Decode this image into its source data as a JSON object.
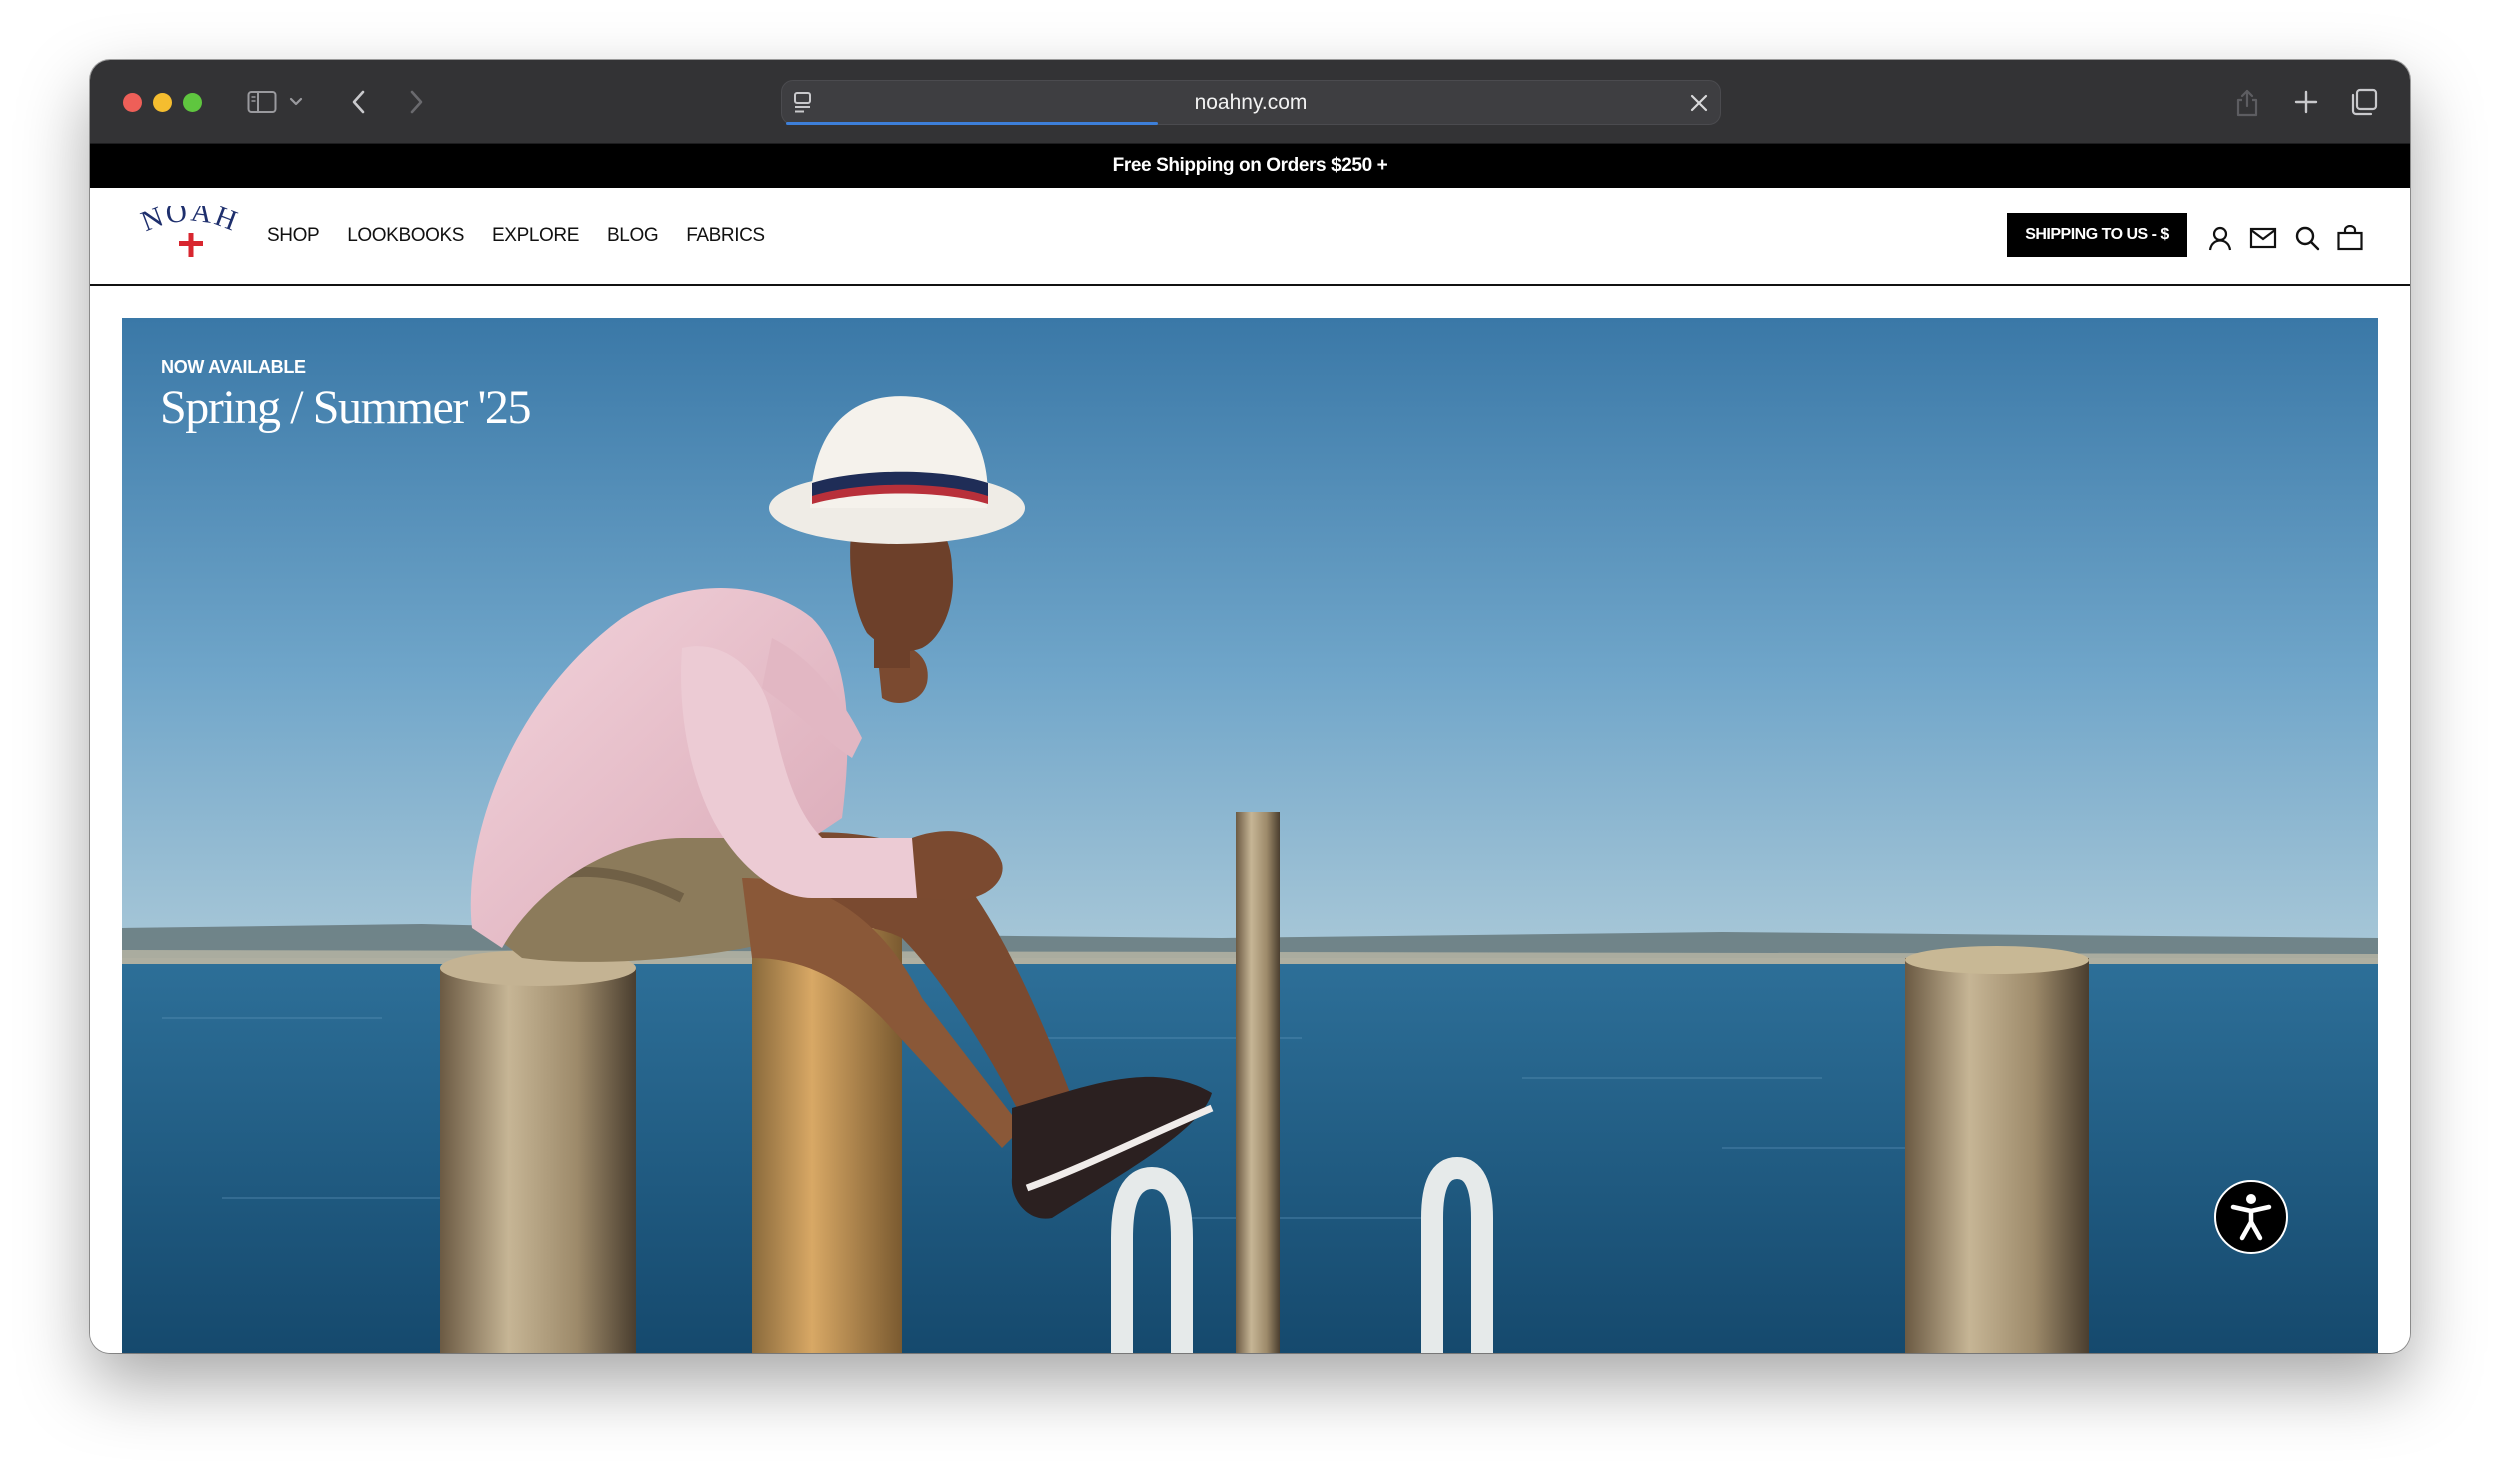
{
  "browser": {
    "url": "noahny.com",
    "load_progress": 0.4
  },
  "promo": {
    "text": "Free Shipping on Orders $250 +"
  },
  "header": {
    "logo_text": "NOAH",
    "nav": [
      "SHOP",
      "LOOKBOOKS",
      "EXPLORE",
      "BLOG",
      "FABRICS"
    ],
    "shipping_label": "SHIPPING TO US - $"
  },
  "hero": {
    "eyebrow": "NOW AVAILABLE",
    "title": "Spring / Summer '25"
  },
  "colors": {
    "chrome_bg": "#333335",
    "promo_bg": "#000000",
    "brand_navy": "#1e2f6d",
    "brand_red": "#d8262f",
    "sky": "#3e86b4",
    "sea": "#1f5d86"
  },
  "icons": {
    "sidebar": "sidebar-icon",
    "back": "chevron-left-icon",
    "forward": "chevron-right-icon",
    "share": "share-icon",
    "new_tab": "plus-icon",
    "tabs": "tabs-overview-icon",
    "account": "user-icon",
    "newsletter": "mail-icon",
    "search": "search-icon",
    "cart": "shopping-bag-icon",
    "accessibility": "accessibility-icon"
  }
}
